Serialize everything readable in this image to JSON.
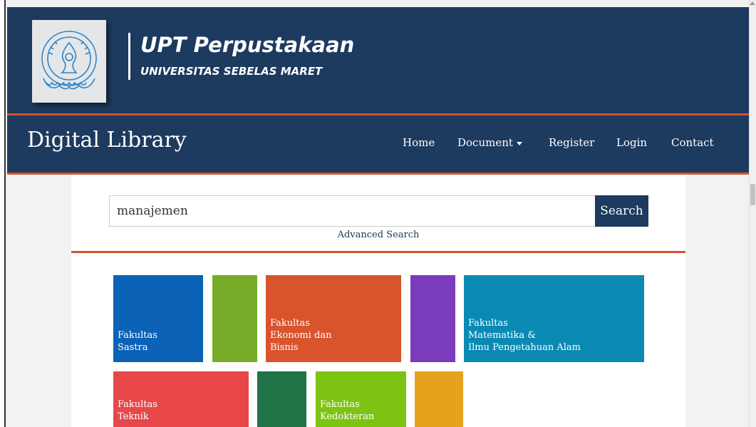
{
  "header": {
    "title": "UPT Perpustakaan",
    "subtitle": "UNIVERSITAS SEBELAS MARET",
    "logo_icon": "uns-logo-icon"
  },
  "nav": {
    "brand": "Digital Library",
    "items": [
      {
        "label": "Home"
      },
      {
        "label": "Document",
        "has_caret": true
      },
      {
        "label": "Register"
      },
      {
        "label": "Login"
      },
      {
        "label": "Contact"
      }
    ]
  },
  "search": {
    "value": "manajemen",
    "placeholder": "",
    "button_label": "Search",
    "advanced_label": "Advanced Search"
  },
  "tiles": [
    {
      "label": "Fakultas\nSastra",
      "color": "#0b62b7"
    },
    {
      "label": "",
      "color": "#78ac28"
    },
    {
      "label": "Fakultas\nEkonomi dan\nBisnis",
      "color": "#d9532c"
    },
    {
      "label": "",
      "color": "#7a3bbd"
    },
    {
      "label": "Fakultas\nMatematika &\nIlmu Pengetahuan Alam",
      "color": "#0a8ab3"
    },
    {
      "label": "Fakultas\nTeknik",
      "color": "#e8474a"
    },
    {
      "label": "",
      "color": "#1f7347"
    },
    {
      "label": "Fakultas\nKedokteran",
      "color": "#7dc313"
    },
    {
      "label": "",
      "color": "#e6a21d"
    }
  ],
  "colors": {
    "navy": "#1d3a5f",
    "accent": "#d6532b",
    "page_bg": "#f2f2f2"
  }
}
